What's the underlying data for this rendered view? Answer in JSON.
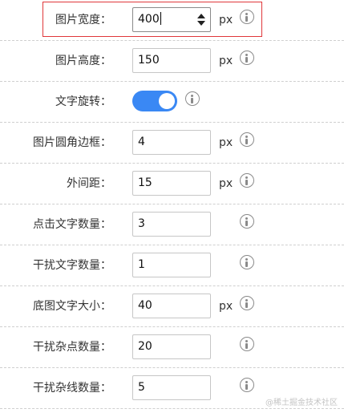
{
  "fields": [
    {
      "label": "图片宽度：",
      "value": "400",
      "unit": "px"
    },
    {
      "label": "图片高度：",
      "value": "150",
      "unit": "px"
    },
    {
      "label": "文字旋转：",
      "toggle_on": true
    },
    {
      "label": "图片圆角边框：",
      "value": "4",
      "unit": "px"
    },
    {
      "label": "外间距：",
      "value": "15",
      "unit": "px"
    },
    {
      "label": "点击文字数量：",
      "value": "3"
    },
    {
      "label": "干扰文字数量：",
      "value": "1"
    },
    {
      "label": "底图文字大小：",
      "value": "40",
      "unit": "px"
    },
    {
      "label": "干扰杂点数量：",
      "value": "20"
    },
    {
      "label": "干扰杂线数量：",
      "value": "5"
    }
  ],
  "icons": {
    "info": "info-circle-icon",
    "spinner": "spinner-arrows-icon"
  },
  "colors": {
    "toggle": "#3a88f4",
    "highlight": "#e0373a",
    "info_icon": "#8a8a8a"
  },
  "watermark": "@稀土掘金技术社区"
}
